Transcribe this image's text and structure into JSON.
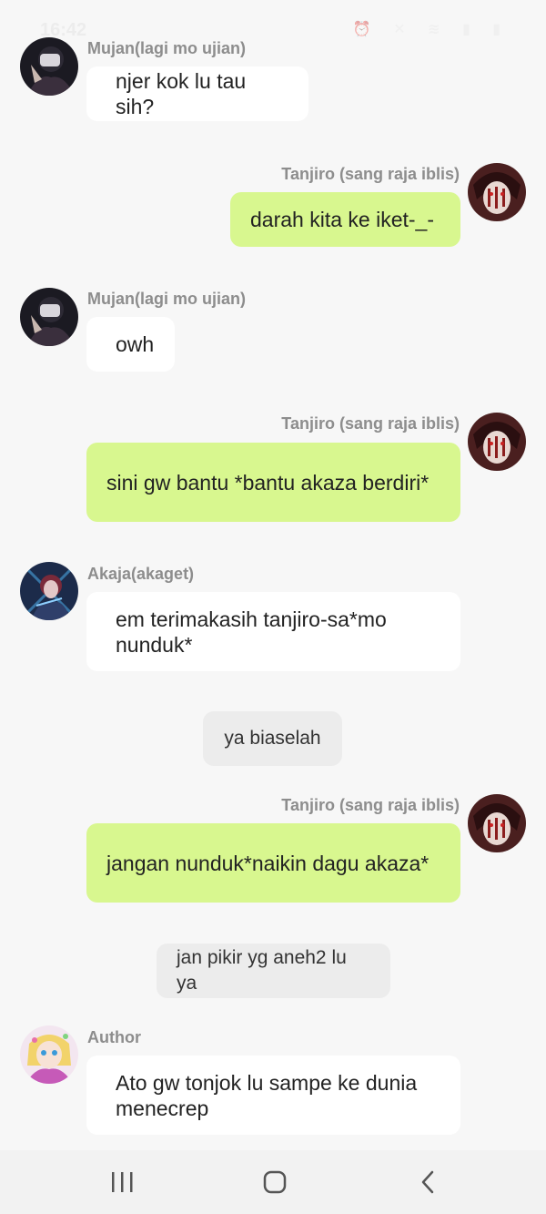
{
  "status_bar": {
    "time": "16:42"
  },
  "messages": [
    {
      "sender": "Mujan(lagi mo ujian)",
      "text": "njer kok lu tau sih?"
    },
    {
      "sender": "Tanjiro (sang raja iblis)",
      "text": "darah kita ke iket-_-"
    },
    {
      "sender": "Mujan(lagi mo ujian)",
      "text": "owh"
    },
    {
      "sender": "Tanjiro (sang raja iblis)",
      "text": "sini gw bantu *bantu akaza berdiri*"
    },
    {
      "sender": "Akaja(akaget)",
      "text": "em terimakasih tanjiro-sa*mo nunduk*"
    },
    {
      "text": "ya biaselah"
    },
    {
      "sender": "Tanjiro (sang raja iblis)",
      "text": "jangan nunduk*naikin dagu akaza*"
    },
    {
      "text": "jan pikir yg aneh2 lu ya"
    },
    {
      "sender": "Author",
      "text": "Ato gw tonjok lu sampe ke dunia menecrep"
    }
  ],
  "colors": {
    "background": "#f7f7f7",
    "bubble_other": "#ffffff",
    "bubble_self": "#d8f78f",
    "bubble_narration": "#ececec",
    "sender_name": "#8d8d8d"
  },
  "icons": {
    "nav_recents": "recents-icon",
    "nav_home": "home-icon",
    "nav_back": "back-icon"
  }
}
